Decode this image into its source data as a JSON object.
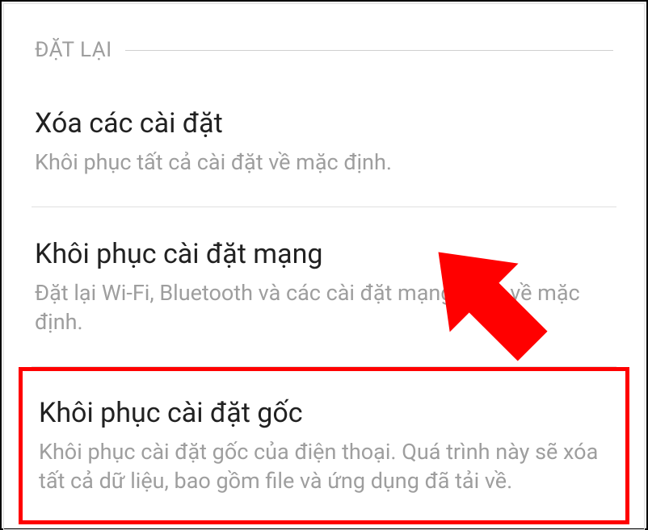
{
  "section": {
    "label": "ĐẶT LẠI"
  },
  "items": [
    {
      "title": "Xóa các cài đặt",
      "description": "Khôi phục tất cả cài đặt về mặc định."
    },
    {
      "title": "Khôi phục cài đặt mạng",
      "description": "Đặt lại Wi-Fi, Bluetooth và các cài đặt mạng khác về mặc định."
    },
    {
      "title": "Khôi phục cài đặt gốc",
      "description": "Khôi phục cài đặt gốc của điện thoại. Quá trình này sẽ xóa tất cả dữ liệu, bao gồm file và ứng dụng đã tải về."
    }
  ]
}
